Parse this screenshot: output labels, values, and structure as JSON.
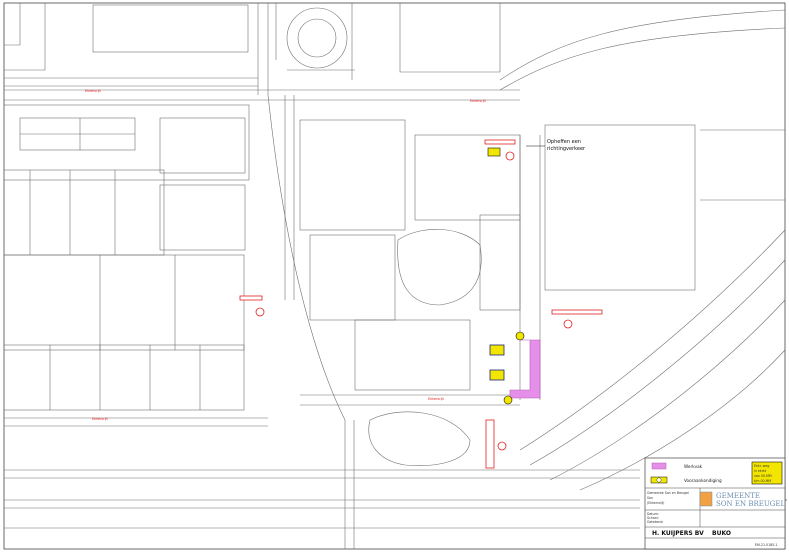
{
  "map": {
    "street_labels": [
      "Ekkersrijt",
      "Ekkersrijt",
      "Ekkersrijt",
      "Ekkersrijt"
    ],
    "annotation": [
      "Opheffen een",
      "richtingverkeer"
    ],
    "colors": {
      "lines": "#6f6f6f",
      "red": "#e02020",
      "magenta": "#e68fe8",
      "yellow": "#f2e600"
    }
  },
  "legend": {
    "items": [
      {
        "label": "Werkvak",
        "icon": "werkvak-swatch"
      },
      {
        "label": "Vooraankondiging",
        "icon": "vooraankondiging-sign"
      }
    ],
    "notice_sign": [
      "Ekkr. weg",
      "in ekrkt",
      "van 00-MM",
      "t/m 00-MM"
    ]
  },
  "title_block": {
    "project_lines": [
      "Gemeente Son en Breugel",
      "Son",
      "(Ekkersrijt)"
    ],
    "small_lines": [
      "Datum:",
      "Schaal:",
      "Getekend:"
    ],
    "municipality": [
      "GEMEENTE",
      "SON EN BREUGEL"
    ],
    "contractor": "H. KUIJPERS BV",
    "brand": "BUKO",
    "drawing_number": "EM-21-0185-1"
  }
}
